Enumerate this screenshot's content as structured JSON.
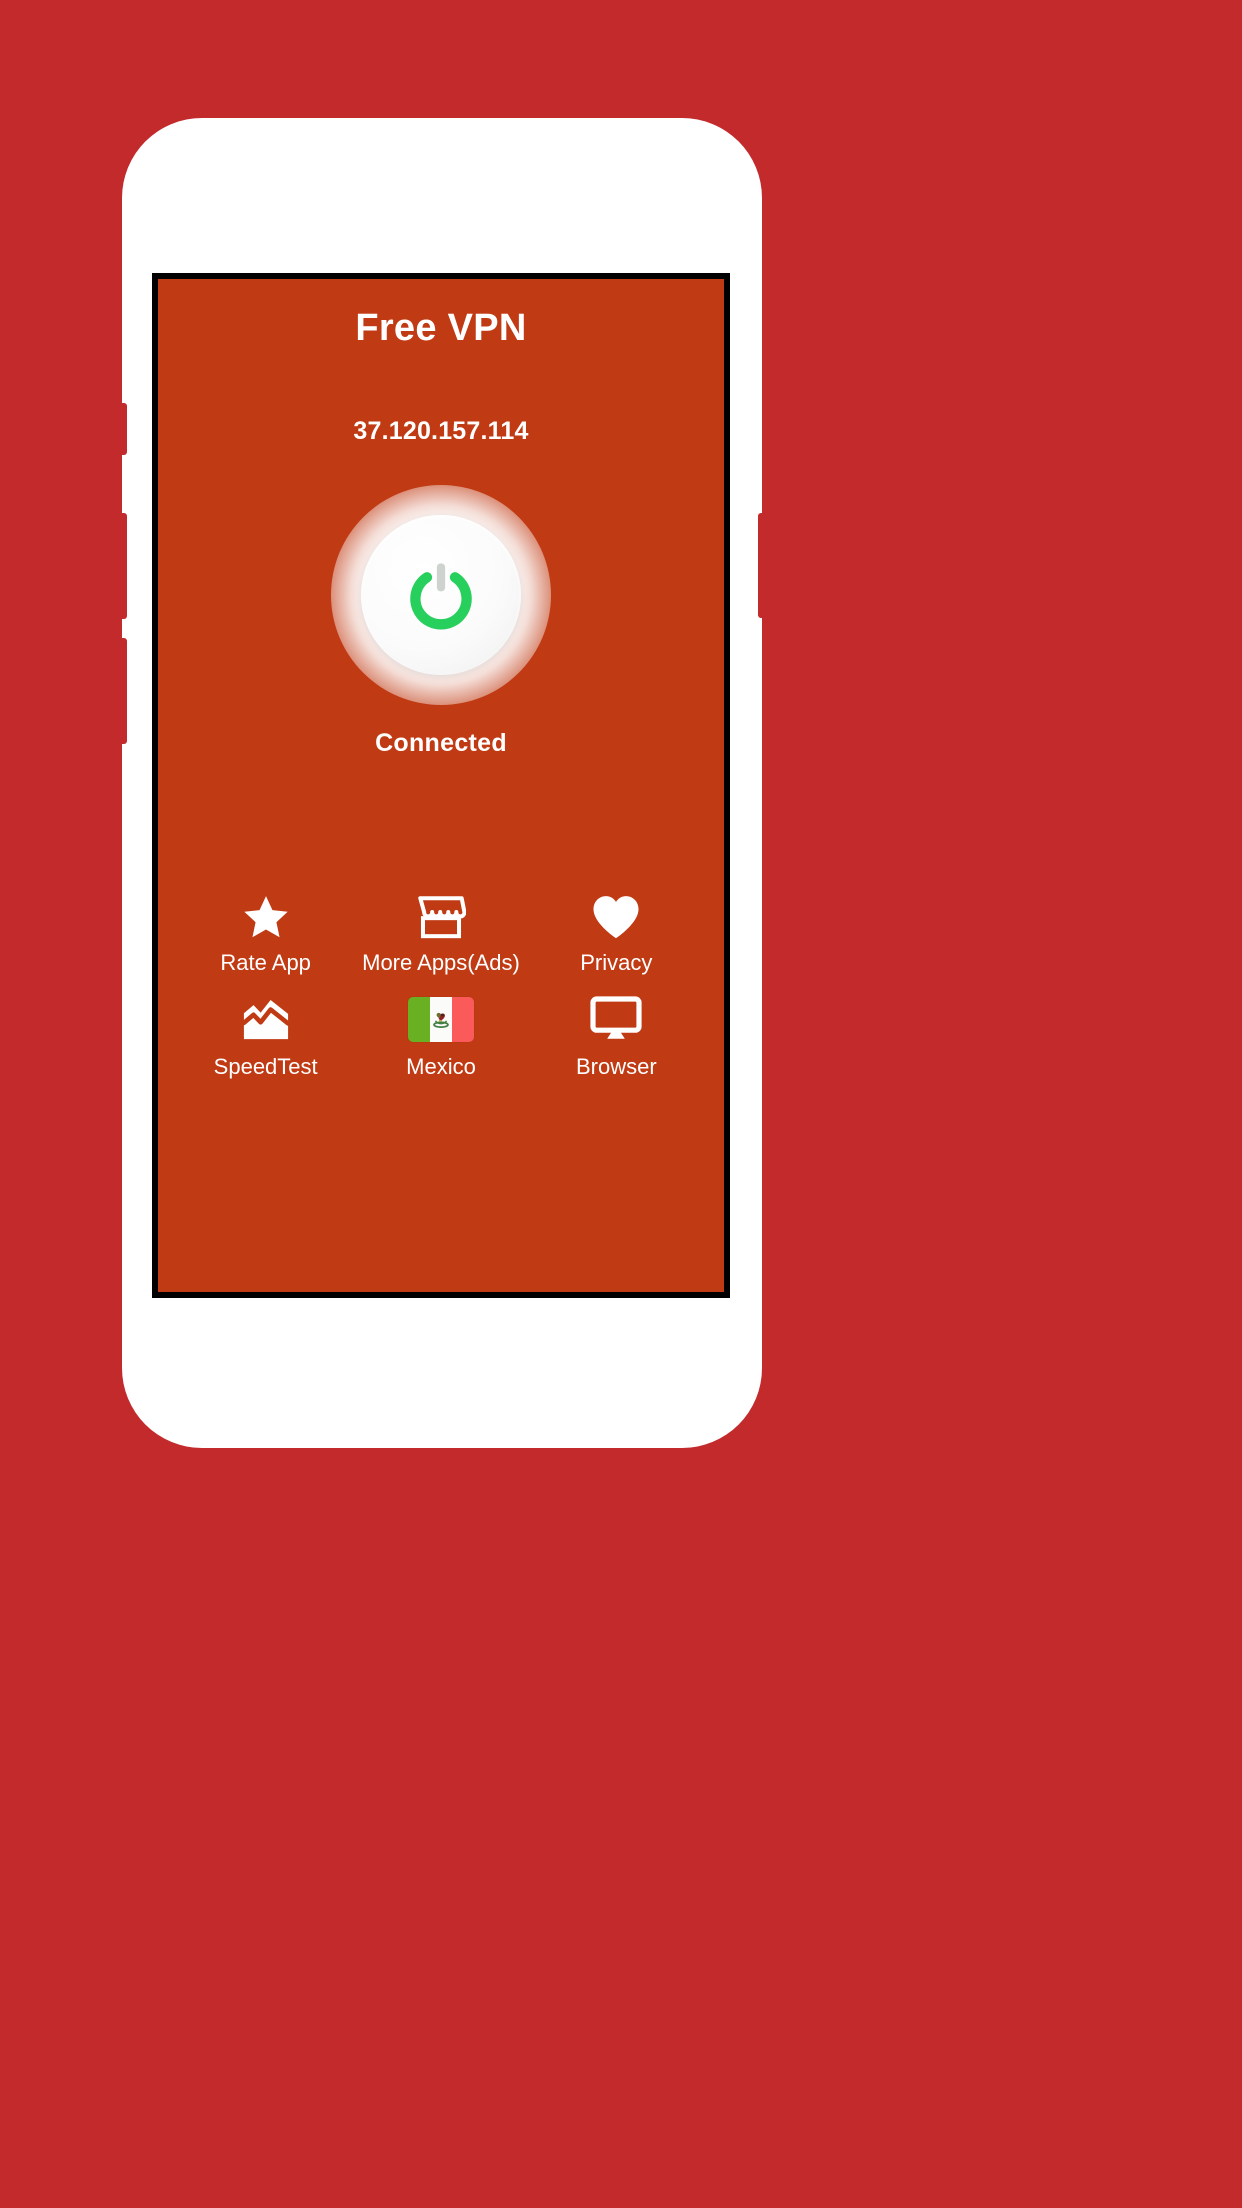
{
  "background": {
    "color": "#c32a2c"
  },
  "phone": {
    "body_color": "#ffffff",
    "bezel_color": "#000000",
    "buttons": [
      "mute-switch",
      "volume-up",
      "volume-down",
      "power"
    ]
  },
  "app": {
    "screen_color": "#c03a13",
    "title": "Free VPN",
    "ip_address": "37.120.157.114",
    "status": "Connected",
    "power_button": {
      "icon": "power-icon",
      "icon_color": "#27cf5d",
      "state": "on",
      "button_color": "#ffffff"
    },
    "grid": {
      "row1": [
        {
          "icon": "star-icon",
          "label": "Rate App"
        },
        {
          "icon": "storefront-icon",
          "label": "More Apps(Ads)"
        },
        {
          "icon": "heart-icon",
          "label": "Privacy"
        }
      ],
      "row2": [
        {
          "icon": "mountain-chart-icon",
          "label": "SpeedTest"
        },
        {
          "icon": "mexico-flag-icon",
          "label": "Mexico"
        },
        {
          "icon": "monitor-icon",
          "label": "Browser"
        }
      ]
    }
  }
}
